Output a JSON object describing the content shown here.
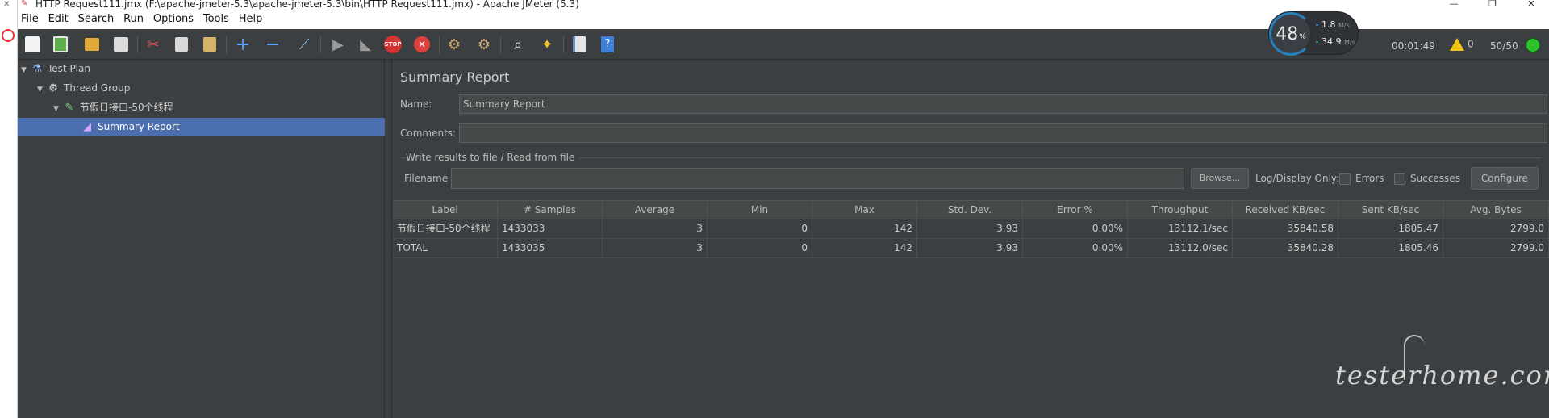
{
  "window": {
    "title": "HTTP Request111.jmx (F:\\apache-jmeter-5.3\\apache-jmeter-5.3\\bin\\HTTP Request111.jmx) - Apache JMeter (5.3)"
  },
  "menu": {
    "items": [
      {
        "label": "File"
      },
      {
        "label": "Edit"
      },
      {
        "label": "Search"
      },
      {
        "label": "Run"
      },
      {
        "label": "Options"
      },
      {
        "label": "Tools"
      },
      {
        "label": "Help"
      }
    ]
  },
  "toolbar": {
    "icons": [
      "new-icon",
      "templates-icon",
      "open-icon",
      "save-icon",
      "cut-icon",
      "copy-icon",
      "paste-icon",
      "expand-icon",
      "collapse-icon",
      "toggle-icon",
      "start-icon",
      "start-no-pauses-icon",
      "stop-icon",
      "shutdown-icon",
      "clear-icon",
      "clear-all-icon",
      "search-icon",
      "reset-search-icon",
      "function-helper-icon",
      "help-icon"
    ]
  },
  "status": {
    "elapsed": "00:01:49",
    "warnings": "0",
    "threads": "50/50",
    "status_color": "#2fbf2f"
  },
  "network_widget": {
    "cpu_percent": "48",
    "cpu_unit": "%",
    "upload": "1.8",
    "upload_unit": "M/s",
    "download": "34.9",
    "download_unit": "M/s"
  },
  "tree": {
    "nodes": [
      {
        "label": "Test Plan",
        "icon": "flask-icon"
      },
      {
        "label": "Thread Group",
        "icon": "gear-icon"
      },
      {
        "label": "节假日接口-50个线程",
        "icon": "sampler-pen-icon"
      },
      {
        "label": "Summary Report",
        "icon": "report-icon"
      }
    ]
  },
  "panel": {
    "title": "Summary Report",
    "name_label": "Name:",
    "name_value": "Summary Report",
    "comments_label": "Comments:",
    "comments_value": "",
    "file_section_title": "Write results to file / Read from file",
    "filename_label": "Filename",
    "filename_value": "",
    "browse_label": "Browse...",
    "log_display_label": "Log/Display Only:",
    "errors_label": "Errors",
    "successes_label": "Successes",
    "configure_label": "Configure"
  },
  "table": {
    "columns": [
      "Label",
      "# Samples",
      "Average",
      "Min",
      "Max",
      "Std. Dev.",
      "Error %",
      "Throughput",
      "Received KB/sec",
      "Sent KB/sec",
      "Avg. Bytes"
    ],
    "rows": [
      [
        "节假日接口-50个线程",
        "1433033",
        "3",
        "0",
        "142",
        "3.93",
        "0.00%",
        "13112.1/sec",
        "35840.58",
        "1805.47",
        "2799.0"
      ],
      [
        "TOTAL",
        "1433035",
        "3",
        "0",
        "142",
        "3.93",
        "0.00%",
        "13112.0/sec",
        "35840.28",
        "1805.46",
        "2799.0"
      ]
    ]
  },
  "watermark": {
    "text": "testerhome.com"
  }
}
